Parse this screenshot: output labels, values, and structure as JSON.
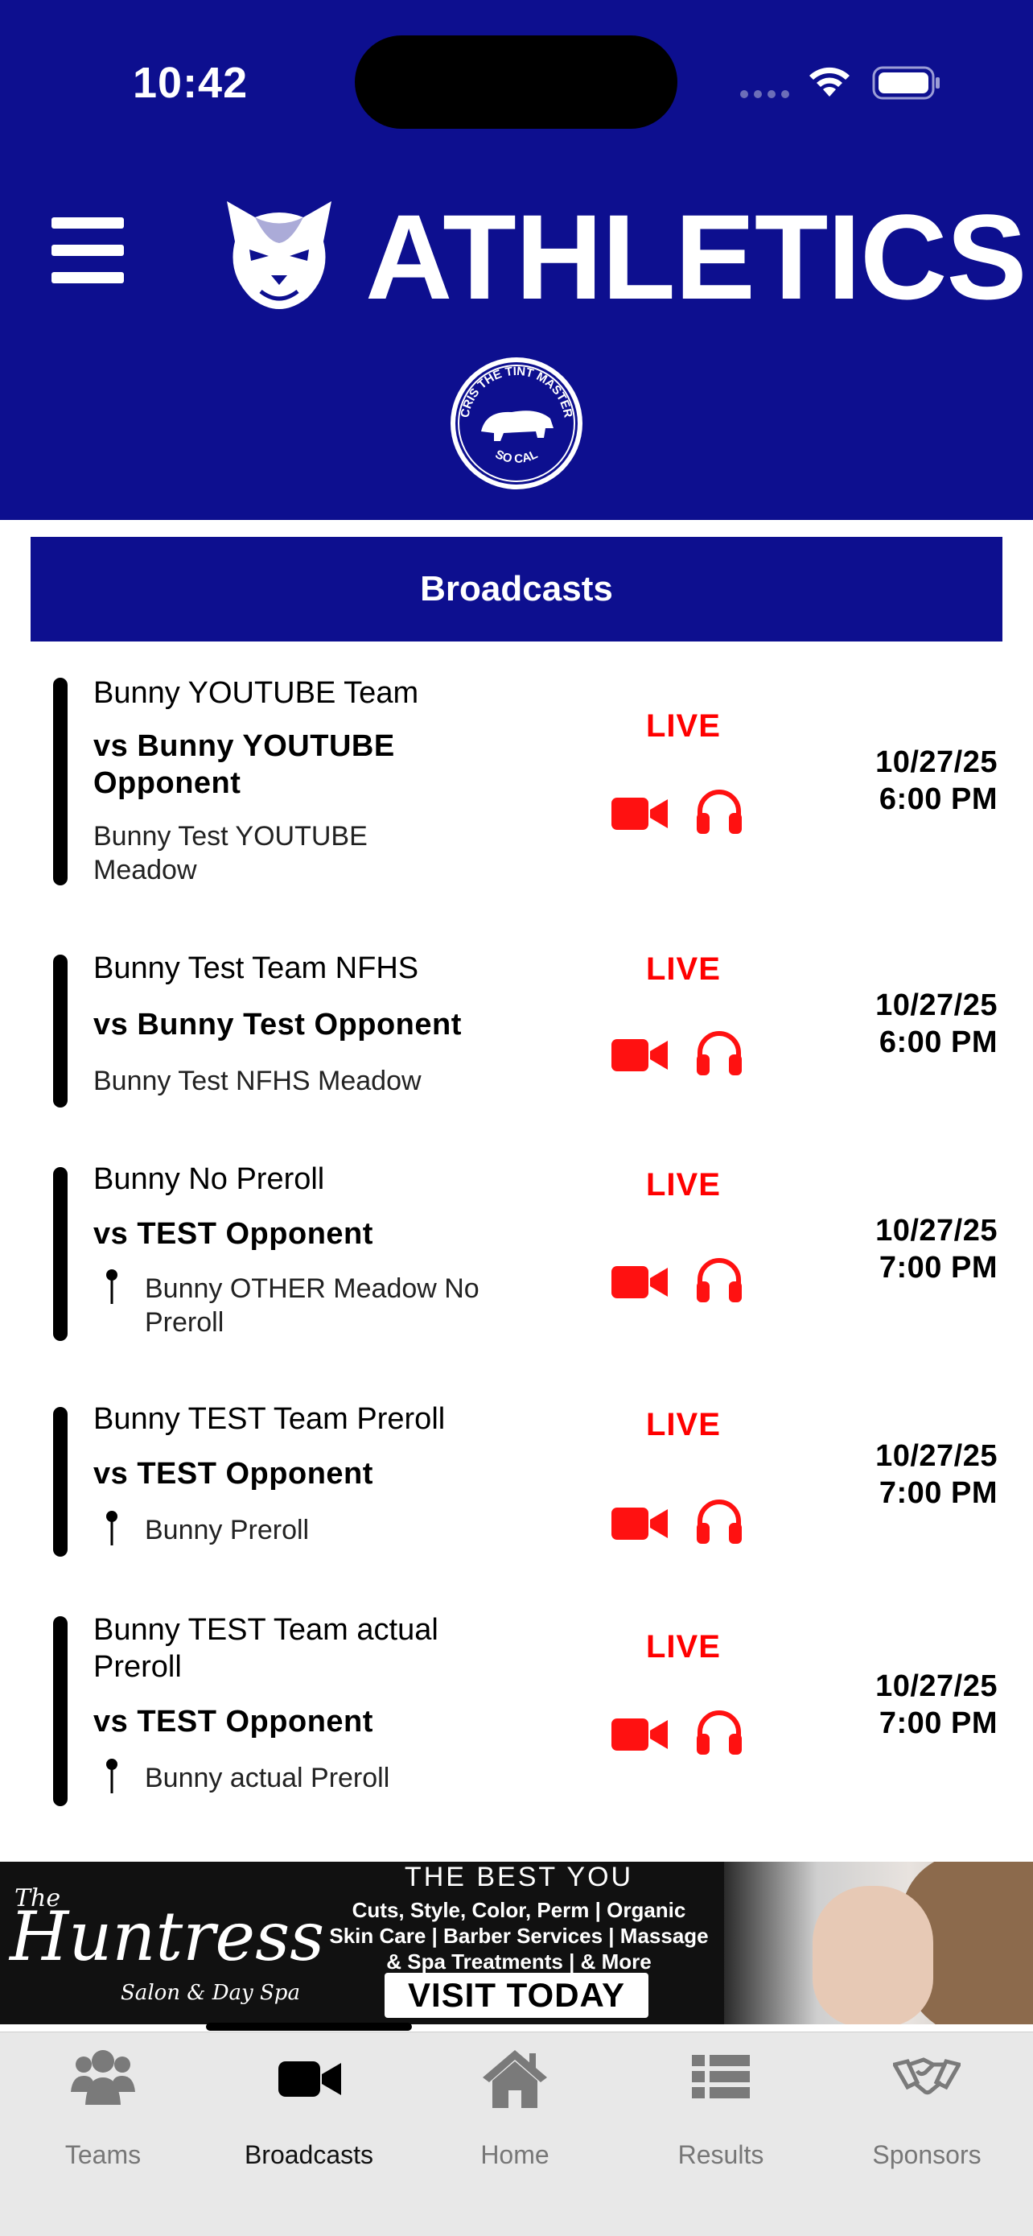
{
  "status_bar": {
    "time": "10:42"
  },
  "header": {
    "title": "ATHLETICS"
  },
  "sponsor_seal": {
    "top_text": "CRIS THE TINT MASTER",
    "bottom_text": "SO CAL"
  },
  "section": {
    "title": "Broadcasts"
  },
  "broadcasts": [
    {
      "team": "Bunny YOUTUBE Team",
      "opponent": "vs Bunny YOUTUBE Opponent",
      "venue": "Bunny Test YOUTUBE Meadow",
      "status": "LIVE",
      "date": "10/27/25",
      "time": "6:00 PM"
    },
    {
      "team": "Bunny Test Team NFHS",
      "opponent": "vs Bunny Test Opponent",
      "venue": "Bunny Test NFHS Meadow",
      "status": "LIVE",
      "date": "10/27/25",
      "time": "6:00 PM"
    },
    {
      "team": "Bunny No Preroll",
      "opponent": "vs TEST Opponent",
      "venue": "Bunny OTHER Meadow No Preroll",
      "status": "LIVE",
      "date": "10/27/25",
      "time": "7:00 PM"
    },
    {
      "team": "Bunny TEST Team Preroll",
      "opponent": "vs TEST Opponent",
      "venue": "Bunny Preroll",
      "status": "LIVE",
      "date": "10/27/25",
      "time": "7:00 PM"
    },
    {
      "team": "Bunny TEST Team actual Preroll",
      "opponent": "vs TEST Opponent",
      "venue": "Bunny actual Preroll",
      "status": "LIVE",
      "date": "10/27/25",
      "time": "7:00 PM"
    }
  ],
  "ad": {
    "small": "The",
    "brand": "Huntress",
    "brand_sub": "Salon & Day Spa",
    "headline": "THE BEST YOU",
    "line1": "Cuts, Style, Color, Perm | Organic",
    "line2": "Skin Care | Barber Services | Massage",
    "line3": "& Spa Treatments | & More",
    "cta": "VISIT TODAY"
  },
  "tabs": [
    {
      "label": "Teams",
      "icon": "people-icon"
    },
    {
      "label": "Broadcasts",
      "icon": "video-camera-icon",
      "active": true
    },
    {
      "label": "Home",
      "icon": "home-icon"
    },
    {
      "label": "Results",
      "icon": "list-icon"
    },
    {
      "label": "Sponsors",
      "icon": "handshake-icon"
    }
  ],
  "colors": {
    "brand_blue": "#0d0f8f",
    "live_red": "#ff0000",
    "tab_bar": "#e8e8e8"
  }
}
